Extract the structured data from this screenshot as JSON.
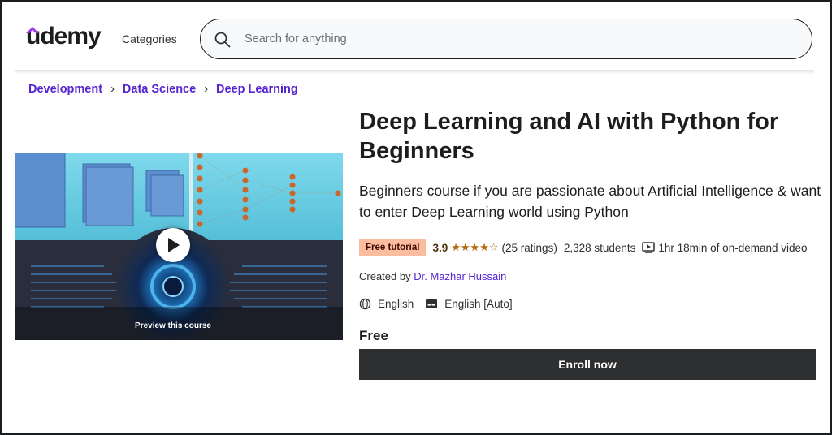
{
  "header": {
    "logo": "udemy",
    "categories_label": "Categories",
    "search_placeholder": "Search for anything"
  },
  "breadcrumb": [
    "Development",
    "Data Science",
    "Deep Learning"
  ],
  "course": {
    "title": "Deep Learning and AI with Python for Beginners",
    "subtitle": "Beginners course if you are passionate about Artificial Intelligence & want to enter Deep Learning world using Python",
    "badge": "Free tutorial",
    "rating": "3.9",
    "rating_value": 3.9,
    "stars": "★★★★☆",
    "ratings_count": "(25 ratings)",
    "students": "2,328 students",
    "duration": "1hr 18min of on-demand video",
    "created_by_label": "Created by",
    "instructor": "Dr. Mazhar Hussain",
    "language": "English",
    "captions": "English [Auto]",
    "price": "Free",
    "enroll_label": "Enroll now",
    "preview_label": "Preview this course"
  },
  "colors": {
    "brand_purple": "#5624d0",
    "badge_bg": "#fcbca0",
    "star": "#b4690e",
    "button_bg": "#2d2f31"
  },
  "icons": [
    "search-icon",
    "play-icon",
    "star-icon",
    "video-icon",
    "globe-icon",
    "captions-icon"
  ]
}
